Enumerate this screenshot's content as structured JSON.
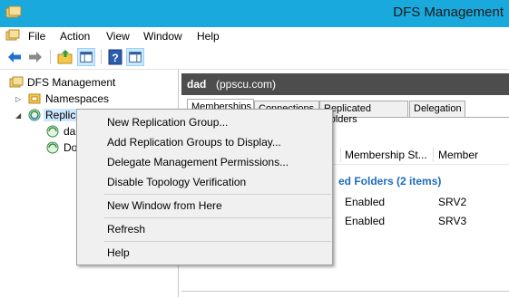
{
  "window": {
    "title": "DFS Management"
  },
  "menu": {
    "items": [
      "File",
      "Action",
      "View",
      "Window",
      "Help"
    ]
  },
  "toolbar": {
    "icons": [
      "back-arrow-icon",
      "forward-arrow-icon",
      "up-folder-icon",
      "show-hide-console-tree-icon",
      "help-icon",
      "show-hide-action-pane-icon"
    ]
  },
  "tree": {
    "root": "DFS Management",
    "namespaces": "Namespaces",
    "replication": "Replic",
    "child1": "da",
    "child2": "Do"
  },
  "content": {
    "node": "dad",
    "path": "(ppscu.com)",
    "tabs": [
      "Memberships",
      "Connections",
      "Replicated Folders",
      "Delegation"
    ],
    "columns": [
      "Membership St...",
      "Member"
    ],
    "group_label": "ed Folders (2 items)",
    "rows": [
      {
        "status": "Enabled",
        "member": "SRV2"
      },
      {
        "status": "Enabled",
        "member": "SRV3"
      }
    ]
  },
  "context_menu": {
    "items": [
      "New Replication Group...",
      "Add Replication Groups to Display...",
      "Delegate Management Permissions...",
      "Disable Topology Verification",
      "New Window from Here",
      "Refresh",
      "Help"
    ]
  },
  "colors": {
    "titlebar": "#19a9dc",
    "selection": "#cce8ff",
    "header": "#4d4d4d",
    "group": "#1e6bbd"
  }
}
